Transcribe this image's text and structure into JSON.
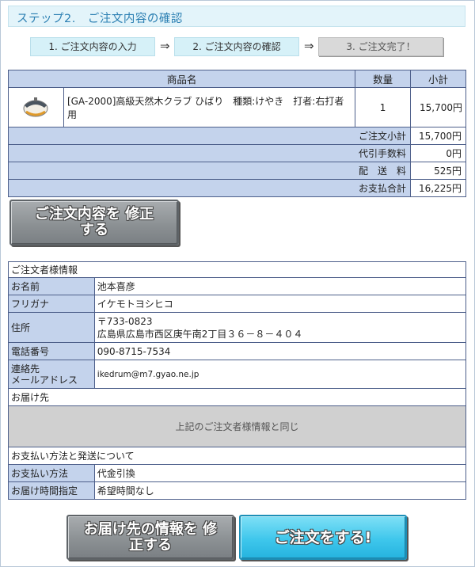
{
  "header": {
    "title": "ステップ2.　ご注文内容の確認"
  },
  "progress": {
    "steps": [
      "1. ご注文内容の入力",
      "2. ご注文内容の確認",
      "3. ご注文完了！"
    ],
    "arrow": "⇒"
  },
  "cart": {
    "headers": {
      "product": "商品名",
      "qty": "数量",
      "subtotal": "小計"
    },
    "item": {
      "image_icon": "golf-club-head-icon",
      "name": "[GA-2000]高級天然木クラブ ひばり　種類:けやき　打者:右打者用",
      "qty": "1",
      "price": "15,700円"
    },
    "summary": [
      {
        "label": "ご注文小計",
        "value": "15,700円"
      },
      {
        "label": "代引手数料",
        "value": "0円"
      },
      {
        "label": "配　送　料",
        "value": "525円"
      },
      {
        "label": "お支払合計",
        "value": "16,225円"
      }
    ]
  },
  "buttons": {
    "edit_order": "ご注文内容を 修正する",
    "edit_delivery": "お届け先の情報を 修正する",
    "place_order": "ご注文をする!"
  },
  "customer": {
    "section_title": "ご注文者様情報",
    "name_label": "お名前",
    "name": "池本喜彦",
    "kana_label": "フリガナ",
    "kana": "イケモトヨシヒコ",
    "address_label": "住所",
    "postal": "〒733-0823",
    "address": "広島県広島市西区庚午南2丁目３６－８－４０４",
    "phone_label": "電話番号",
    "phone": "090-8715-7534",
    "contact_label_1": "連絡先",
    "contact_label_2": "メールアドレス",
    "email": "ikedrum@m7.gyao.ne.jp"
  },
  "delivery": {
    "section_title": "お届け先",
    "same_text": "上記のご注文者様情報と同じ"
  },
  "payment": {
    "section_title": "お支払い方法と発送について",
    "method_label": "お支払い方法",
    "method": "代金引換",
    "time_label": "お届け時間指定",
    "time": "希望時間なし"
  },
  "colors": {
    "accent": "#2b7fb2",
    "header_bg": "#e3f4fa",
    "table_label_bg": "#c4d3ec",
    "table_border": "#4d5f8a",
    "button_gray": "#8c9194",
    "button_cyan": "#3fc7ec"
  }
}
